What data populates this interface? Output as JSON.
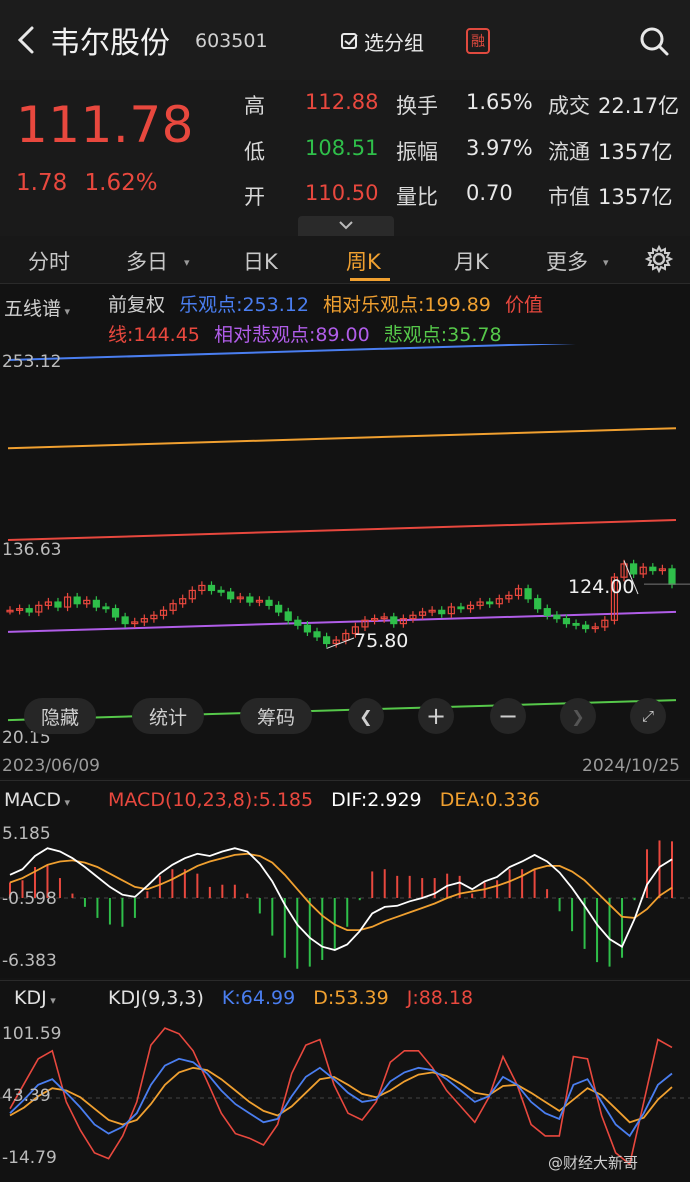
{
  "header": {
    "stock_name": "韦尔股份",
    "stock_code": "603501",
    "pick_group_label": "选分组",
    "margin_badge": "融"
  },
  "quote": {
    "price": "111.78",
    "change": "1.78",
    "change_pct": "1.62%",
    "rows": [
      [
        {
          "label": "高",
          "value": "112.88",
          "color": "#e8483e"
        },
        {
          "label": "换手",
          "value": "1.65%"
        },
        {
          "label": "成交",
          "value": "22.17亿"
        }
      ],
      [
        {
          "label": "低",
          "value": "108.51",
          "color": "#2fbf4a"
        },
        {
          "label": "振幅",
          "value": "3.97%"
        },
        {
          "label": "流通",
          "value": "1357亿"
        }
      ],
      [
        {
          "label": "开",
          "value": "110.50",
          "color": "#e8483e"
        },
        {
          "label": "量比",
          "value": "0.70"
        },
        {
          "label": "市值",
          "value": "1357亿"
        }
      ]
    ]
  },
  "tabs": {
    "items": [
      "分时",
      "多日",
      "日K",
      "周K",
      "月K",
      "更多"
    ],
    "active": "周K"
  },
  "main_chart": {
    "indicator": "五线谱",
    "adjust": "前复权",
    "legend_line1": [
      {
        "text": "乐观点:253.12",
        "color": "#4a7ef0"
      },
      {
        "text": "相对乐观点:199.89",
        "color": "#f0a030"
      },
      {
        "text": "价值",
        "color": "#e8483e"
      }
    ],
    "legend_line2": [
      {
        "text": "线:144.45",
        "color": "#e8483e"
      },
      {
        "text": "相对悲观点:89.00",
        "color": "#b05de8"
      },
      {
        "text": "悲观点:35.78",
        "color": "#56c84a"
      }
    ],
    "axis_top": "253.12",
    "axis_mid": "136.63",
    "axis_bottom": "20.15",
    "date_start": "2023/06/09",
    "date_end": "2024/10/25",
    "annot_high": "124.00",
    "annot_low": "75.80",
    "controls": [
      "隐藏",
      "统计",
      "筹码"
    ],
    "lines": {
      "optimistic": {
        "color": "#4a7ef0",
        "start": 253.12,
        "end": 253.12
      },
      "rel_optimistic": {
        "color": "#f0a030",
        "start": 199.89,
        "end": 199.89
      },
      "value": {
        "color": "#e8483e",
        "start": 144.45,
        "end": 144.45
      },
      "rel_pessimistic": {
        "color": "#b05de8",
        "start": 89.0,
        "end": 89.0
      },
      "pessimistic": {
        "color": "#56c84a",
        "start": 35.78,
        "end": 35.78
      }
    },
    "candles": [
      96,
      97,
      95,
      99,
      101,
      98,
      104,
      100,
      102,
      98,
      97,
      92,
      88,
      89,
      91,
      93,
      96,
      100,
      103,
      108,
      111,
      108,
      107,
      103,
      104,
      101,
      102,
      99,
      95,
      90,
      87,
      83,
      80,
      76,
      78,
      82,
      86,
      90,
      91,
      92,
      88,
      91,
      93,
      95,
      96,
      94,
      98,
      97,
      99,
      101,
      100,
      103,
      105,
      109,
      103,
      97,
      93,
      91,
      88,
      87,
      85,
      86,
      90,
      116,
      124,
      118,
      122,
      120,
      121,
      111.78
    ]
  },
  "macd": {
    "title": "MACD",
    "params": "MACD(10,23,8):5.185",
    "dif": "DIF:2.929",
    "dea": "DEA:0.336",
    "axis_top": "5.185",
    "axis_mid": "-0.598",
    "axis_bottom": "-6.383",
    "colors": {
      "dif": "#ffffff",
      "dea": "#f0a030",
      "up": "#e8483e",
      "down": "#2fbf4a"
    },
    "dif_series": [
      1.5,
      2.0,
      3.2,
      3.9,
      3.6,
      3.0,
      2.2,
      1.3,
      0.4,
      -0.3,
      -0.5,
      0.5,
      1.6,
      2.4,
      3.0,
      3.4,
      3.2,
      3.6,
      3.9,
      3.6,
      2.5,
      0.9,
      -1.2,
      -3.0,
      -4.2,
      -5.0,
      -5.3,
      -4.8,
      -3.6,
      -2.0,
      -1.4,
      -1.3,
      -0.9,
      -0.6,
      -0.2,
      0.5,
      0.8,
      0.2,
      0.9,
      1.3,
      2.2,
      2.7,
      3.3,
      2.7,
      1.7,
      0.3,
      -1.3,
      -3.0,
      -4.3,
      -5.0,
      -2.5,
      0.6,
      2.2,
      2.9
    ],
    "dea_series": [
      0.8,
      1.2,
      1.8,
      2.4,
      2.7,
      2.8,
      2.6,
      2.2,
      1.6,
      1.0,
      0.4,
      0.2,
      0.6,
      1.1,
      1.7,
      2.3,
      2.7,
      3.0,
      3.3,
      3.4,
      3.2,
      2.6,
      1.5,
      0.2,
      -1.1,
      -2.2,
      -3.0,
      -3.5,
      -3.5,
      -3.2,
      -2.7,
      -2.3,
      -1.9,
      -1.5,
      -1.1,
      -0.6,
      -0.2,
      0.0,
      0.2,
      0.5,
      0.9,
      1.4,
      2.0,
      2.3,
      2.3,
      1.8,
      1.0,
      -0.1,
      -1.2,
      -2.3,
      -2.4,
      -1.6,
      -0.4,
      0.34
    ]
  },
  "kdj": {
    "title": "KDJ",
    "params": "KDJ(9,3,3)",
    "k": "K:64.99",
    "d": "D:53.39",
    "j": "J:88.18",
    "axis_top": "101.59",
    "axis_mid": "43.39",
    "axis_bottom": "-14.79",
    "colors": {
      "k": "#4a7ef0",
      "d": "#f0a030",
      "j": "#e8483e"
    },
    "k_series": [
      30,
      42,
      55,
      60,
      48,
      35,
      20,
      12,
      18,
      30,
      55,
      72,
      78,
      75,
      65,
      50,
      38,
      30,
      22,
      25,
      45,
      62,
      70,
      60,
      48,
      40,
      42,
      58,
      66,
      70,
      68,
      60,
      50,
      40,
      45,
      62,
      55,
      40,
      30,
      25,
      55,
      60,
      40,
      20,
      10,
      30,
      55,
      65
    ],
    "d_series": [
      28,
      35,
      45,
      52,
      50,
      44,
      34,
      24,
      20,
      24,
      38,
      55,
      66,
      70,
      68,
      60,
      50,
      40,
      32,
      28,
      36,
      48,
      60,
      62,
      55,
      47,
      44,
      50,
      58,
      64,
      66,
      63,
      56,
      48,
      46,
      54,
      55,
      48,
      40,
      32,
      42,
      52,
      46,
      34,
      22,
      26,
      42,
      53
    ],
    "j_series": [
      34,
      56,
      78,
      85,
      40,
      15,
      -5,
      -10,
      10,
      40,
      90,
      105,
      100,
      85,
      58,
      30,
      12,
      8,
      2,
      20,
      65,
      90,
      95,
      55,
      30,
      24,
      40,
      75,
      85,
      85,
      70,
      50,
      36,
      22,
      44,
      80,
      55,
      20,
      10,
      10,
      80,
      78,
      28,
      -5,
      -15,
      40,
      95,
      88
    ]
  },
  "watermark": "@财经大新哥"
}
